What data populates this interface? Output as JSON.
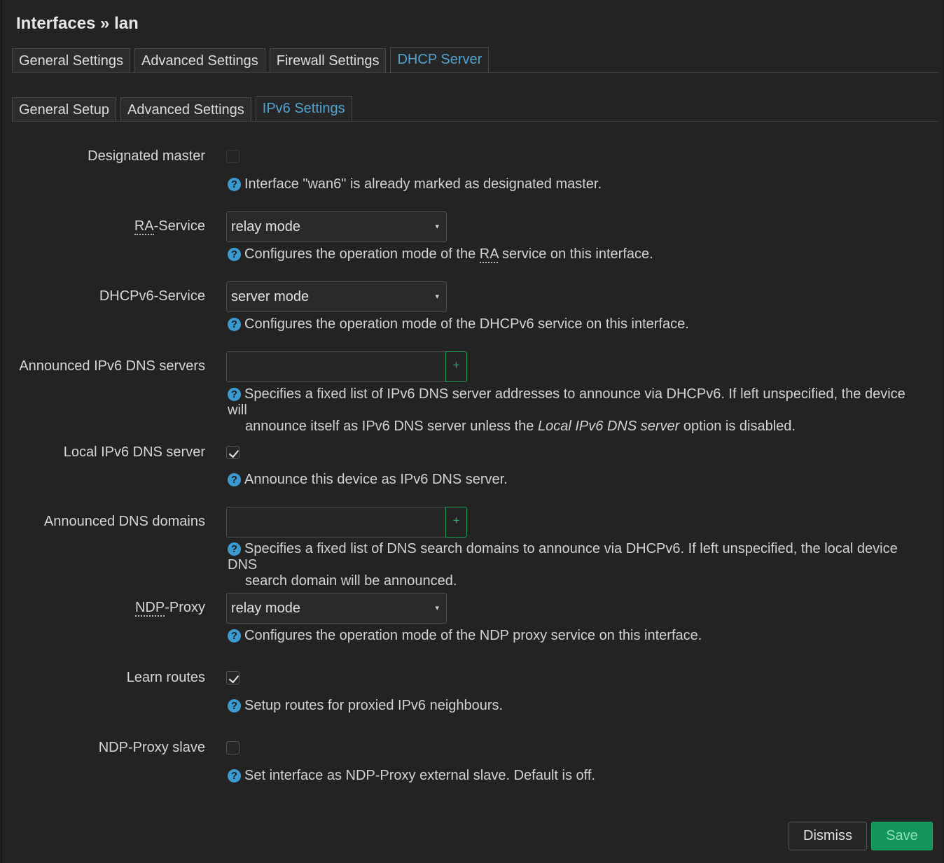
{
  "title": "Interfaces » lan",
  "main_tabs": [
    "General Settings",
    "Advanced Settings",
    "Firewall Settings",
    "DHCP Server"
  ],
  "sub_tabs": [
    "General Setup",
    "Advanced Settings",
    "IPv6 Settings"
  ],
  "fields": {
    "designated_master": {
      "label": "Designated master",
      "checked": false,
      "help": "Interface \"wan6\" is already marked as designated master."
    },
    "ra_service": {
      "label_abbr": "RA",
      "label_rest": "-Service",
      "value": "relay mode",
      "help_pre": "Configures the operation mode of the ",
      "help_abbr": "RA",
      "help_post": " service on this interface."
    },
    "dhcpv6_service": {
      "label": "DHCPv6-Service",
      "value": "server mode",
      "help": "Configures the operation mode of the DHCPv6 service on this interface."
    },
    "dns_servers": {
      "label": "Announced IPv6 DNS servers",
      "add": "+",
      "help_line1": "Specifies a fixed list of IPv6 DNS server addresses to announce via DHCPv6. If left unspecified, the device will",
      "help_line2_pre": "announce itself as IPv6 DNS server unless the ",
      "help_line2_em": "Local IPv6 DNS server",
      "help_line2_post": " option is disabled."
    },
    "local_dns": {
      "label": "Local IPv6 DNS server",
      "checked": true,
      "help": "Announce this device as IPv6 DNS server."
    },
    "dns_domains": {
      "label": "Announced DNS domains",
      "add": "+",
      "help_line1": "Specifies a fixed list of DNS search domains to announce via DHCPv6. If left unspecified, the local device DNS",
      "help_line2": "search domain will be announced."
    },
    "ndp_proxy": {
      "label_abbr": "NDP",
      "label_rest": "-Proxy",
      "value": "relay mode",
      "help": "Configures the operation mode of the NDP proxy service on this interface."
    },
    "learn_routes": {
      "label": "Learn routes",
      "checked": true,
      "help": "Setup routes for proxied IPv6 neighbours."
    },
    "ndp_proxy_slave": {
      "label": "NDP-Proxy slave",
      "checked": false,
      "help": "Set interface as NDP-Proxy external slave. Default is off."
    }
  },
  "help_icon": "?",
  "caret": "▾",
  "buttons": {
    "dismiss": "Dismiss",
    "save": "Save"
  },
  "colors": {
    "accent": "#53a3d1",
    "save": "#12945a",
    "add_border": "#1f9e5a",
    "help_icon": "#3b9ad0"
  }
}
